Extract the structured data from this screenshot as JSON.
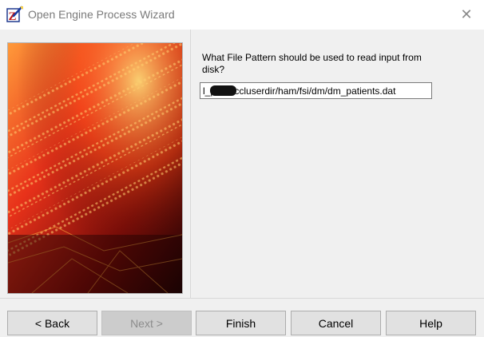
{
  "window": {
    "title": "Open Engine Process Wizard",
    "close_glyph": "✕"
  },
  "icons": {
    "app": "wizard-wand-icon",
    "close": "close-icon"
  },
  "main": {
    "question": "What File Pattern should be used to read input from disk?",
    "file_pattern_value": "l_p      /ccluserdir/ham/fsi/dm/dm_patients.dat"
  },
  "buttons": {
    "back": "< Back",
    "next": "Next >",
    "finish": "Finish",
    "cancel": "Cancel",
    "help": "Help"
  },
  "colors": {
    "image_glow": "#ff4a1a",
    "image_dark": "#2a0505"
  }
}
